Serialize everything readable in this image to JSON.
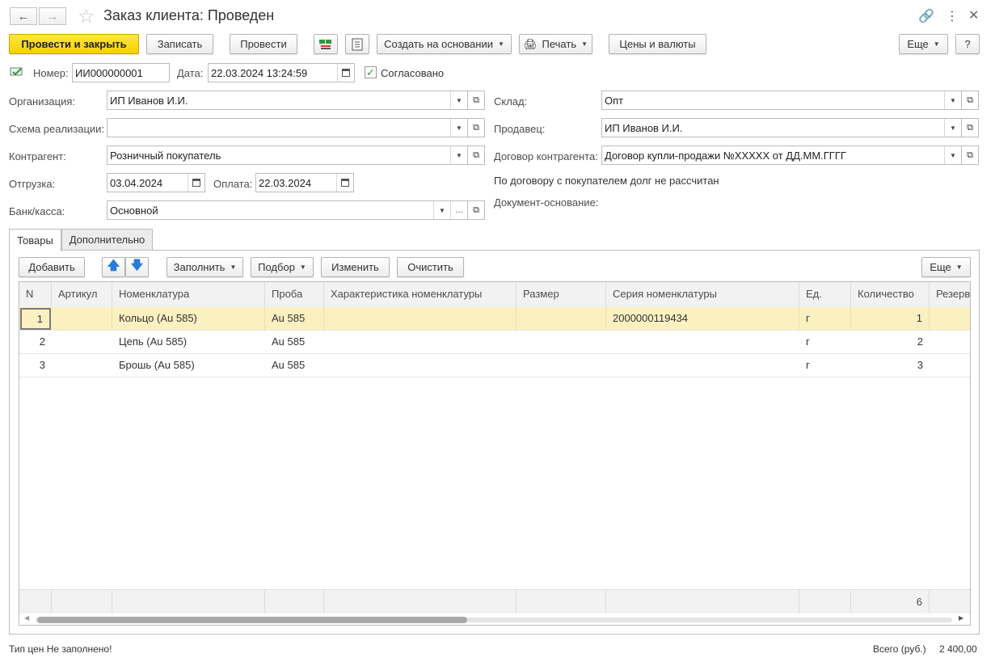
{
  "window": {
    "title": "Заказ клиента: Проведен"
  },
  "toolbar": {
    "post_close": "Провести и закрыть",
    "save": "Записать",
    "post": "Провести",
    "create_based": "Создать на основании",
    "print": "Печать",
    "prices": "Цены и валюты",
    "more": "Еще",
    "help": "?"
  },
  "header": {
    "number_label": "Номер:",
    "number_value": "ИИ000000001",
    "date_label": "Дата:",
    "date_value": "22.03.2024 13:24:59",
    "agreed_label": "Согласовано",
    "agreed_checked": true
  },
  "left_fields": {
    "org_label": "Организация:",
    "org_value": "ИП Иванов И.И.",
    "scheme_label": "Схема реализации:",
    "scheme_value": "",
    "counterparty_label": "Контрагент:",
    "counterparty_value": "Розничный покупатель",
    "shipment_label": "Отгрузка:",
    "shipment_value": "03.04.2024",
    "payment_label": "Оплата:",
    "payment_value": "22.03.2024",
    "bank_label": "Банк/касса:",
    "bank_value": "Основной"
  },
  "right_fields": {
    "warehouse_label": "Склад:",
    "warehouse_value": "Опт",
    "seller_label": "Продавец:",
    "seller_value": "ИП Иванов И.И.",
    "contract_label": "Договор контрагента:",
    "contract_value": "Договор купли-продажи №XXXXX от ДД.ММ.ГГГГ",
    "debt_note": "По договору с покупателем долг не рассчитан",
    "base_doc_label": "Документ-основание:"
  },
  "tabs": {
    "goods": "Товары",
    "extra": "Дополнительно"
  },
  "table_toolbar": {
    "add": "Добавить",
    "fill": "Заполнить",
    "pick": "Подбор",
    "edit": "Изменить",
    "clear": "Очистить",
    "more": "Еще"
  },
  "table": {
    "columns": [
      "N",
      "Артикул",
      "Номенклатура",
      "Проба",
      "Характеристика номенклатуры",
      "Размер",
      "Серия номенклатуры",
      "Ед.",
      "Количество",
      "Резерв"
    ],
    "rows": [
      [
        "1",
        "",
        "Кольцо (Au 585)",
        "Au 585",
        "",
        "",
        "2000000119434",
        "г",
        "1",
        ""
      ],
      [
        "2",
        "",
        "Цепь (Au 585)",
        "Au 585",
        "",
        "",
        "",
        "г",
        "2",
        ""
      ],
      [
        "3",
        "",
        "Брошь (Au 585)",
        "Au 585",
        "",
        "",
        "",
        "г",
        "3",
        ""
      ]
    ],
    "footer_total_qty": "6"
  },
  "status": {
    "price_type": "Тип цен Не заполнено!",
    "total_label": "Всего (руб.)",
    "total_value": "2 400,00"
  },
  "colors": {
    "primary_button": "#f4d100",
    "selected_row": "#fbf0c0",
    "arrow_blue": "#2a7ad8"
  }
}
